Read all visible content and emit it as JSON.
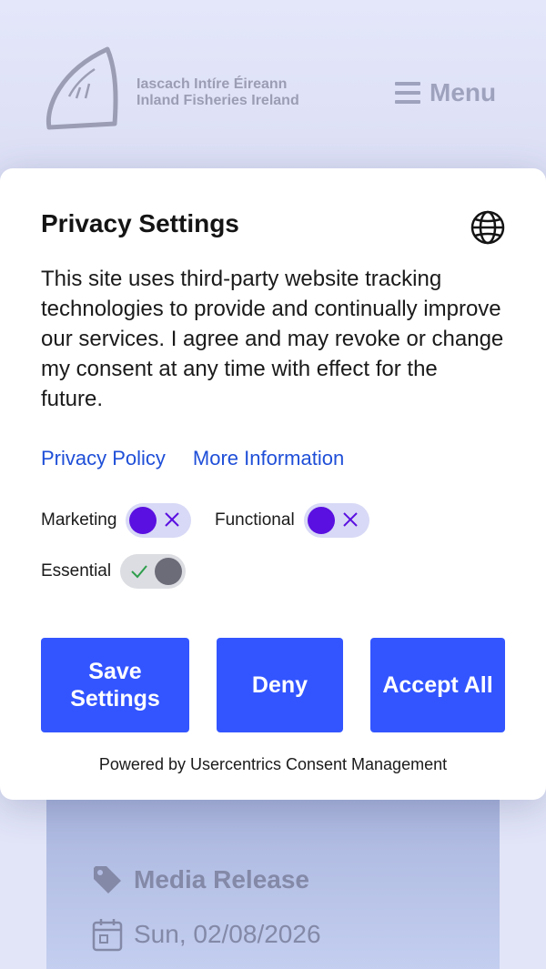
{
  "site": {
    "logo_line1": "Iascach Intíre Éireann",
    "logo_line2": "Inland Fisheries Ireland",
    "menu_label": "Menu",
    "card": {
      "tag_label": "Media Release",
      "date": "Sun, 02/08/2026"
    }
  },
  "consent": {
    "title": "Privacy Settings",
    "description": "This site uses third-party website tracking technologies to provide and continually improve our services.  I agree and may revoke or change my consent at any time with effect for the future.",
    "links": {
      "privacy_policy": "Privacy Policy",
      "more_information": "More Information"
    },
    "toggles": {
      "marketing": {
        "label": "Marketing",
        "enabled": false
      },
      "functional": {
        "label": "Functional",
        "enabled": false
      },
      "essential": {
        "label": "Essential",
        "enabled": true,
        "locked": true
      }
    },
    "buttons": {
      "save": "Save Settings",
      "deny": "Deny",
      "accept": "Accept All"
    },
    "powered_by": "Powered by Usercentrics Consent Management"
  },
  "colors": {
    "accent": "#3355ff",
    "link": "#1f4fd8",
    "toggle_knob": "#5a10e0",
    "toggle_track": "#d8d9f6",
    "backdrop": "#e2e5f8"
  },
  "icons": {
    "logo": "fish-logo-icon",
    "menu": "hamburger-icon",
    "globe": "globe-icon",
    "tag": "tag-icon",
    "calendar": "calendar-icon",
    "toggle_off": "x-icon",
    "toggle_on": "check-icon"
  }
}
